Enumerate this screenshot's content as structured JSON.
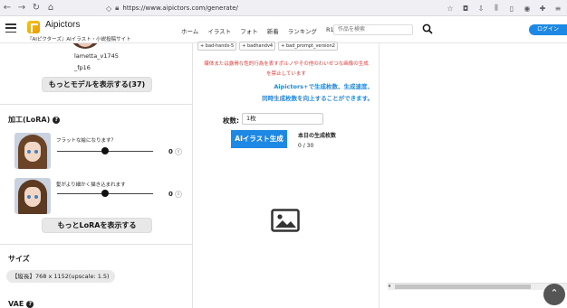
{
  "browser": {
    "url": "https://www.aipictors.com/generate/"
  },
  "site": {
    "logo_text": "Aipictors",
    "tagline": "『AIピクターズ』AIイラスト・小説投稿サイト",
    "nav": [
      "ホーム",
      "イラスト",
      "フォト",
      "新着",
      "ランキング",
      "R18"
    ],
    "search_placeholder": "作品を検索",
    "login_label": "ログイン"
  },
  "left": {
    "model_name_1": "lametta_v1745",
    "model_name_2": "_fp16",
    "more_models_label": "もっとモデルを表示する(37)",
    "lora_title": "加工(LoRA)",
    "loras": [
      {
        "label": "フラットな絵になります？",
        "value": "0",
        "level": 0.5
      },
      {
        "label": "髪がより細かく描き込まれます",
        "value": "0",
        "level": 0.5
      }
    ],
    "more_lora_label": "もっとLoRAを表示する",
    "size_title": "サイズ",
    "size_value": "【縦長】768 x 1152(upscale: 1.5)",
    "vae_title": "VAE"
  },
  "middle": {
    "negative_tags": [
      "bad-hands-5",
      "badhandv4",
      "bad_prompt_version2"
    ],
    "warning_line1": "爆体または露骨な性的行為を表すポルノやその他のわいせつな画像の生成",
    "warning_line2": "を禁止しています",
    "info_line1": "Aipictors+で生成枚数、生成速度、",
    "info_line2": "同時生成枚数を向上することができます。",
    "count_label": "枚数:",
    "count_value": "1枚",
    "generate_label": "AIイラスト生成",
    "today_label": "本日の生成枚数",
    "today_value": "0 / 30"
  },
  "colors": {
    "accent": "#1e88e5",
    "warning": "#e53935"
  }
}
